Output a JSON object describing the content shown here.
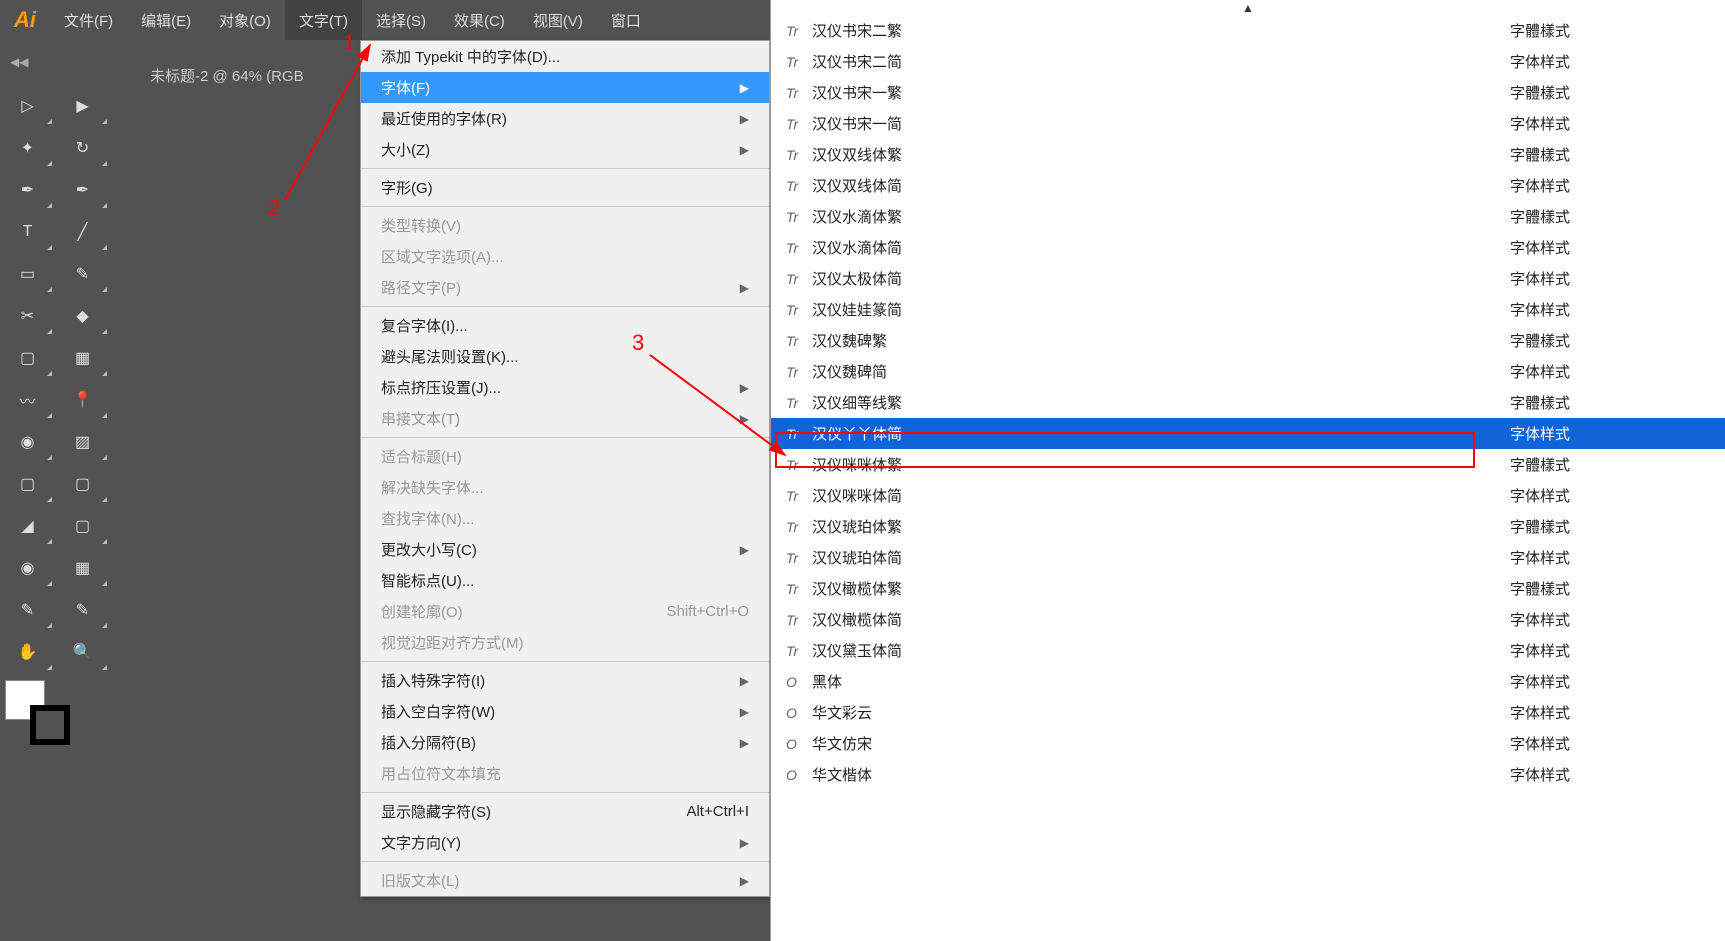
{
  "menubar": {
    "items": [
      "文件(F)",
      "编辑(E)",
      "对象(O)",
      "文字(T)",
      "选择(S)",
      "效果(C)",
      "视图(V)",
      "窗口"
    ]
  },
  "doc_tab": "未标题-2 @ 64% (RGB",
  "dropdown": {
    "groups": [
      [
        {
          "label": "添加 Typekit 中的字体(D)...",
          "disabled": false
        },
        {
          "label": "字体(F)",
          "arrow": true,
          "highlighted": true
        },
        {
          "label": "最近使用的字体(R)",
          "arrow": true
        },
        {
          "label": "大小(Z)",
          "arrow": true
        }
      ],
      [
        {
          "label": "字形(G)"
        }
      ],
      [
        {
          "label": "类型转换(V)",
          "disabled": true
        },
        {
          "label": "区域文字选项(A)...",
          "disabled": true
        },
        {
          "label": "路径文字(P)",
          "arrow": true,
          "disabled": true
        }
      ],
      [
        {
          "label": "复合字体(I)..."
        },
        {
          "label": "避头尾法则设置(K)..."
        },
        {
          "label": "标点挤压设置(J)...",
          "arrow": true
        },
        {
          "label": "串接文本(T)",
          "arrow": true,
          "disabled": true
        }
      ],
      [
        {
          "label": "适合标题(H)",
          "disabled": true
        },
        {
          "label": "解决缺失字体...",
          "disabled": true
        },
        {
          "label": "查找字体(N)...",
          "disabled": true
        },
        {
          "label": "更改大小写(C)",
          "arrow": true
        },
        {
          "label": "智能标点(U)..."
        },
        {
          "label": "创建轮廓(O)",
          "shortcut": "Shift+Ctrl+O",
          "disabled": true
        },
        {
          "label": "视觉边距对齐方式(M)",
          "disabled": true
        }
      ],
      [
        {
          "label": "插入特殊字符(I)",
          "arrow": true
        },
        {
          "label": "插入空白字符(W)",
          "arrow": true
        },
        {
          "label": "插入分隔符(B)",
          "arrow": true
        },
        {
          "label": "用占位符文本填充",
          "disabled": true
        }
      ],
      [
        {
          "label": "显示隐藏字符(S)",
          "shortcut": "Alt+Ctrl+I"
        },
        {
          "label": "文字方向(Y)",
          "arrow": true
        }
      ],
      [
        {
          "label": "旧版文本(L)",
          "arrow": true,
          "disabled": true
        }
      ]
    ]
  },
  "fonts": [
    {
      "icon": "Tr",
      "name": "汉仪书宋二繁",
      "sample": "字體樣式"
    },
    {
      "icon": "Tr",
      "name": "汉仪书宋二简",
      "sample": "字体样式"
    },
    {
      "icon": "Tr",
      "name": "汉仪书宋一繁",
      "sample": "字體樣式"
    },
    {
      "icon": "Tr",
      "name": "汉仪书宋一简",
      "sample": "字体样式"
    },
    {
      "icon": "Tr",
      "name": "汉仪双线体繁",
      "sample": "字體樣式"
    },
    {
      "icon": "Tr",
      "name": "汉仪双线体简",
      "sample": "字体样式"
    },
    {
      "icon": "Tr",
      "name": "汉仪水滴体繁",
      "sample": "字體樣式"
    },
    {
      "icon": "Tr",
      "name": "汉仪水滴体简",
      "sample": "字体样式"
    },
    {
      "icon": "Tr",
      "name": "汉仪太极体简",
      "sample": "字体样式"
    },
    {
      "icon": "Tr",
      "name": "汉仪娃娃篆简",
      "sample": "字体样式"
    },
    {
      "icon": "Tr",
      "name": "汉仪魏碑繁",
      "sample": "字體樣式"
    },
    {
      "icon": "Tr",
      "name": "汉仪魏碑简",
      "sample": "字体样式"
    },
    {
      "icon": "Tr",
      "name": "汉仪细等线繁",
      "sample": "字體樣式"
    },
    {
      "icon": "Tr",
      "name": "汉仪丫丫体简",
      "sample": "字体样式",
      "selected": true
    },
    {
      "icon": "Tr",
      "name": "汉仪咪咪体繁",
      "sample": "字體樣式"
    },
    {
      "icon": "Tr",
      "name": "汉仪咪咪体简",
      "sample": "字体样式"
    },
    {
      "icon": "Tr",
      "name": "汉仪琥珀体繁",
      "sample": "字體樣式"
    },
    {
      "icon": "Tr",
      "name": "汉仪琥珀体简",
      "sample": "字体样式"
    },
    {
      "icon": "Tr",
      "name": "汉仪橄榄体繁",
      "sample": "字體樣式"
    },
    {
      "icon": "Tr",
      "name": "汉仪橄榄体简",
      "sample": "字体样式"
    },
    {
      "icon": "Tr",
      "name": "汉仪黛玉体简",
      "sample": "字体样式"
    },
    {
      "icon": "O",
      "name": "黑体",
      "sample": "字体样式"
    },
    {
      "icon": "O",
      "name": "华文彩云",
      "sample": "字体样式"
    },
    {
      "icon": "O",
      "name": "华文仿宋",
      "sample": "字体样式"
    },
    {
      "icon": "O",
      "name": "华文楷体",
      "sample": "字体样式"
    }
  ],
  "annotations": {
    "n1": "1",
    "n2": "2",
    "n3": "3"
  },
  "tool_icons": [
    "▷",
    "▶",
    "✦",
    "↻",
    "✒",
    "✒",
    "T",
    "╱",
    "▭",
    "✎",
    "✂",
    "◆",
    "▢",
    "▦",
    "〰",
    "📍",
    "◉",
    "▨",
    "▢",
    "▢",
    "◢",
    "▢",
    "◉",
    "▦",
    "✎",
    "✎",
    "✋",
    "🔍"
  ]
}
